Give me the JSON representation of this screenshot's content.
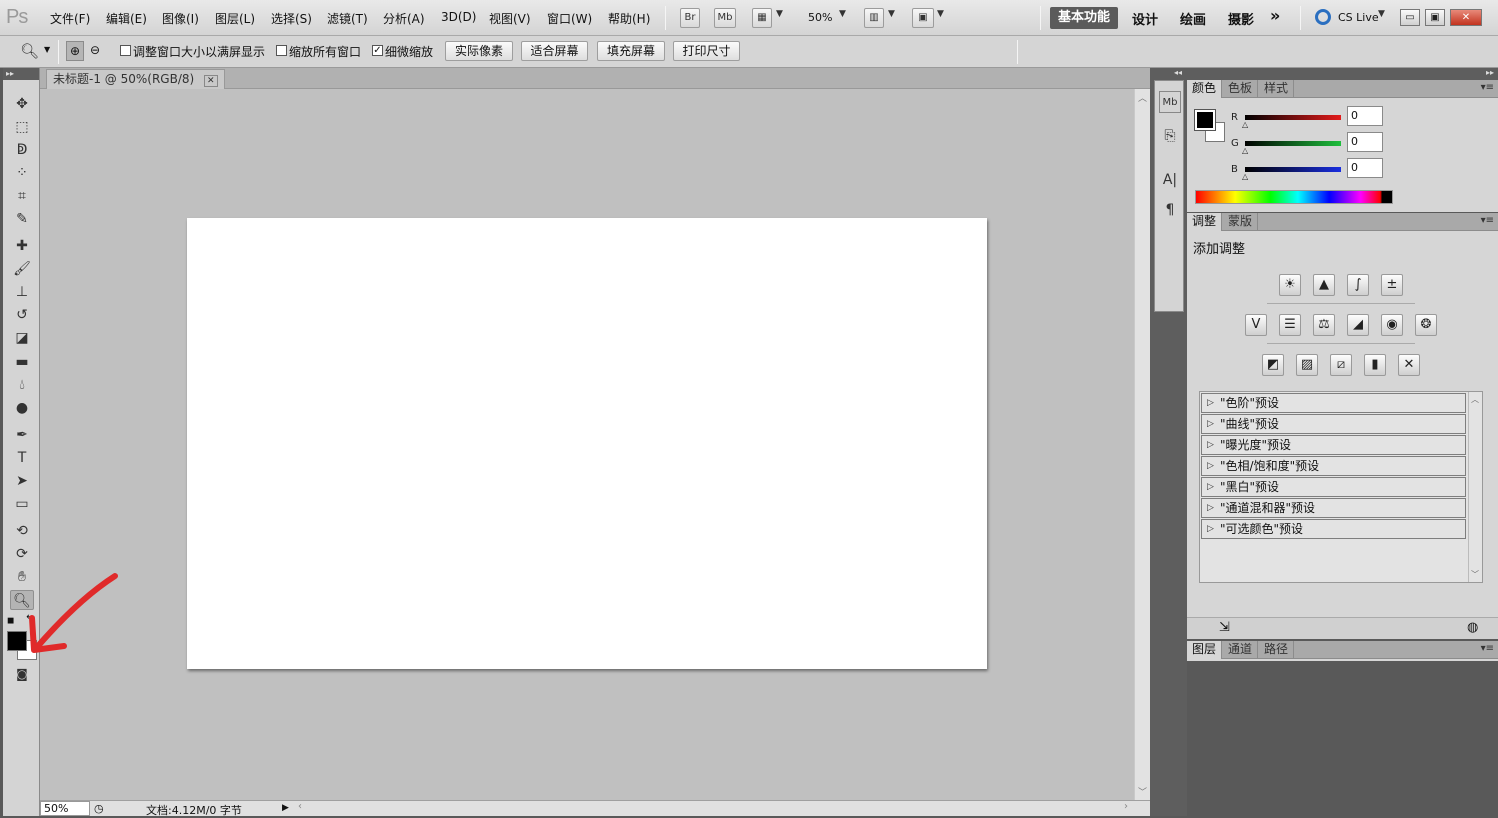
{
  "app": {
    "logo": "Ps"
  },
  "menu": [
    "文件(F)",
    "编辑(E)",
    "图像(I)",
    "图层(L)",
    "选择(S)",
    "滤镜(T)",
    "分析(A)",
    "3D(D)",
    "视图(V)",
    "窗口(W)",
    "帮助(H)"
  ],
  "appbar": {
    "bridge": "Br",
    "minibridge": "Mb",
    "zoom": "50%"
  },
  "workspaces": {
    "active": "基本功能",
    "items": [
      "设计",
      "绘画",
      "摄影"
    ],
    "more": "»",
    "cslive": "CS Live"
  },
  "window_controls": {
    "minimize": "▭",
    "restore": "▣",
    "close": "✕"
  },
  "options": {
    "resize_windows": "调整窗口大小以满屏显示",
    "zoom_all": "缩放所有窗口",
    "scrubby_zoom": "细微缩放",
    "actual_pixels": "实际像素",
    "fit_screen": "适合屏幕",
    "fill_screen": "填充屏幕",
    "print_size": "打印尺寸",
    "checked": {
      "resize_windows": false,
      "zoom_all": false,
      "scrubby_zoom": true
    }
  },
  "document": {
    "tab_title": "未标题-1 @ 50%(RGB/8)",
    "close": "✕"
  },
  "status": {
    "zoom": "50%",
    "doc_info": "文档:4.12M/0 字节"
  },
  "color_panel": {
    "tabs": [
      "颜色",
      "色板",
      "样式"
    ],
    "channels": [
      {
        "label": "R",
        "value": "0",
        "color": "#d01a1a"
      },
      {
        "label": "G",
        "value": "0",
        "color": "#1fa83a"
      },
      {
        "label": "B",
        "value": "0",
        "color": "#1a2fd0"
      }
    ]
  },
  "adjust_panel": {
    "tabs": [
      "调整",
      "蒙版"
    ],
    "title": "添加调整",
    "presets": [
      "\"色阶\"预设",
      "\"曲线\"预设",
      "\"曝光度\"预设",
      "\"色相/饱和度\"预设",
      "\"黑白\"预设",
      "\"通道混和器\"预设",
      "\"可选颜色\"预设"
    ]
  },
  "layers_panel": {
    "tabs": [
      "图层",
      "通道",
      "路径"
    ]
  },
  "colors": {
    "foreground": "#000000",
    "background": "#ffffff",
    "annotation_arrow": "#e02a2a"
  }
}
